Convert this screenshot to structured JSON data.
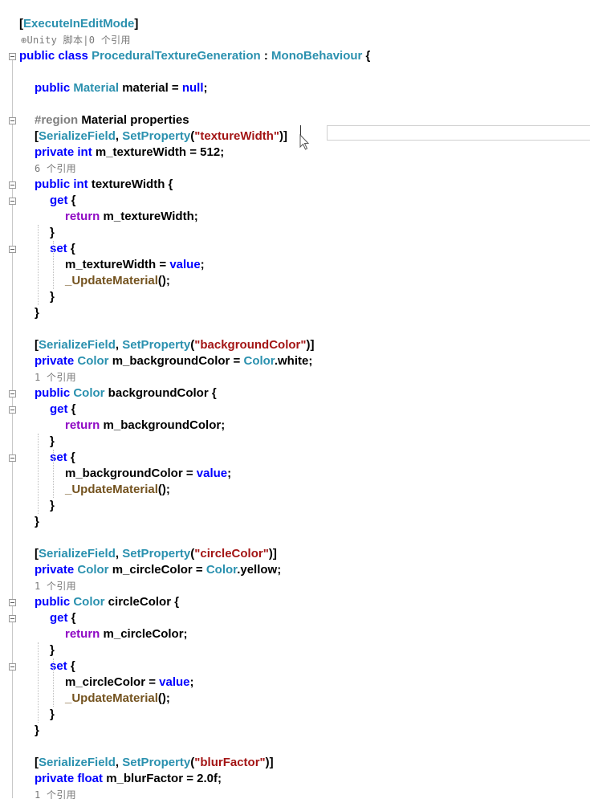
{
  "lines": [
    {
      "indent": 0,
      "tokens": [
        [
          "pun",
          "["
        ],
        [
          "attr",
          "ExecuteInEditMode"
        ],
        [
          "pun",
          "]"
        ]
      ]
    },
    {
      "indent": 0,
      "lens": "⊕Unity 脚本|0 个引用"
    },
    {
      "indent": 0,
      "tokens": [
        [
          "kw",
          "public "
        ],
        [
          "kw",
          "class "
        ],
        [
          "type",
          "ProceduralTextureGeneration"
        ],
        [
          "txt",
          " : "
        ],
        [
          "type",
          "MonoBehaviour"
        ],
        [
          "txt",
          " {"
        ]
      ]
    },
    {
      "indent": 0,
      "tokens": []
    },
    {
      "indent": 1,
      "tokens": [
        [
          "kw",
          "public "
        ],
        [
          "type",
          "Material"
        ],
        [
          "txt",
          " material = "
        ],
        [
          "kw",
          "null"
        ],
        [
          "txt",
          ";"
        ]
      ]
    },
    {
      "indent": 0,
      "tokens": []
    },
    {
      "indent": 1,
      "tokens": [
        [
          "dir",
          "#region "
        ],
        [
          "txt",
          "Material properties"
        ]
      ]
    },
    {
      "indent": 1,
      "tokens": [
        [
          "pun",
          "["
        ],
        [
          "attr",
          "SerializeField"
        ],
        [
          "txt",
          ", "
        ],
        [
          "attr",
          "SetProperty"
        ],
        [
          "txt",
          "("
        ],
        [
          "str",
          "\"textureWidth\""
        ],
        [
          "txt",
          ")]"
        ]
      ]
    },
    {
      "indent": 1,
      "tokens": [
        [
          "kw",
          "private "
        ],
        [
          "kw",
          "int "
        ],
        [
          "txt",
          "m_textureWidth = 512;"
        ]
      ]
    },
    {
      "indent": 1,
      "lens": "6 个引用"
    },
    {
      "indent": 1,
      "tokens": [
        [
          "kw",
          "public "
        ],
        [
          "kw",
          "int "
        ],
        [
          "txt",
          "textureWidth {"
        ]
      ]
    },
    {
      "indent": 2,
      "tokens": [
        [
          "kw",
          "get "
        ],
        [
          "txt",
          "{"
        ]
      ]
    },
    {
      "indent": 3,
      "tokens": [
        [
          "ctl",
          "return "
        ],
        [
          "txt",
          "m_textureWidth;"
        ]
      ]
    },
    {
      "indent": 2,
      "tokens": [
        [
          "txt",
          "}"
        ]
      ]
    },
    {
      "indent": 2,
      "tokens": [
        [
          "kw",
          "set "
        ],
        [
          "txt",
          "{"
        ]
      ]
    },
    {
      "indent": 3,
      "tokens": [
        [
          "txt",
          "m_textureWidth = "
        ],
        [
          "kw",
          "value"
        ],
        [
          "txt",
          ";"
        ]
      ]
    },
    {
      "indent": 3,
      "tokens": [
        [
          "meth",
          "_UpdateMaterial"
        ],
        [
          "txt",
          "();"
        ]
      ]
    },
    {
      "indent": 2,
      "tokens": [
        [
          "txt",
          "}"
        ]
      ]
    },
    {
      "indent": 1,
      "tokens": [
        [
          "txt",
          "}"
        ]
      ]
    },
    {
      "indent": 0,
      "tokens": []
    },
    {
      "indent": 1,
      "tokens": [
        [
          "pun",
          "["
        ],
        [
          "attr",
          "SerializeField"
        ],
        [
          "txt",
          ", "
        ],
        [
          "attr",
          "SetProperty"
        ],
        [
          "txt",
          "("
        ],
        [
          "str",
          "\"backgroundColor\""
        ],
        [
          "txt",
          ")]"
        ]
      ]
    },
    {
      "indent": 1,
      "tokens": [
        [
          "kw",
          "private "
        ],
        [
          "type",
          "Color"
        ],
        [
          "txt",
          " m_backgroundColor = "
        ],
        [
          "type",
          "Color"
        ],
        [
          "txt",
          ".white;"
        ]
      ]
    },
    {
      "indent": 1,
      "lens": "1 个引用"
    },
    {
      "indent": 1,
      "tokens": [
        [
          "kw",
          "public "
        ],
        [
          "type",
          "Color"
        ],
        [
          "txt",
          " backgroundColor {"
        ]
      ]
    },
    {
      "indent": 2,
      "tokens": [
        [
          "kw",
          "get "
        ],
        [
          "txt",
          "{"
        ]
      ]
    },
    {
      "indent": 3,
      "tokens": [
        [
          "ctl",
          "return "
        ],
        [
          "txt",
          "m_backgroundColor;"
        ]
      ]
    },
    {
      "indent": 2,
      "tokens": [
        [
          "txt",
          "}"
        ]
      ]
    },
    {
      "indent": 2,
      "tokens": [
        [
          "kw",
          "set "
        ],
        [
          "txt",
          "{"
        ]
      ]
    },
    {
      "indent": 3,
      "tokens": [
        [
          "txt",
          "m_backgroundColor = "
        ],
        [
          "kw",
          "value"
        ],
        [
          "txt",
          ";"
        ]
      ]
    },
    {
      "indent": 3,
      "tokens": [
        [
          "meth",
          "_UpdateMaterial"
        ],
        [
          "txt",
          "();"
        ]
      ]
    },
    {
      "indent": 2,
      "tokens": [
        [
          "txt",
          "}"
        ]
      ]
    },
    {
      "indent": 1,
      "tokens": [
        [
          "txt",
          "}"
        ]
      ]
    },
    {
      "indent": 0,
      "tokens": []
    },
    {
      "indent": 1,
      "tokens": [
        [
          "pun",
          "["
        ],
        [
          "attr",
          "SerializeField"
        ],
        [
          "txt",
          ", "
        ],
        [
          "attr",
          "SetProperty"
        ],
        [
          "txt",
          "("
        ],
        [
          "str",
          "\"circleColor\""
        ],
        [
          "txt",
          ")]"
        ]
      ]
    },
    {
      "indent": 1,
      "tokens": [
        [
          "kw",
          "private "
        ],
        [
          "type",
          "Color"
        ],
        [
          "txt",
          " m_circleColor = "
        ],
        [
          "type",
          "Color"
        ],
        [
          "txt",
          ".yellow;"
        ]
      ]
    },
    {
      "indent": 1,
      "lens": "1 个引用"
    },
    {
      "indent": 1,
      "tokens": [
        [
          "kw",
          "public "
        ],
        [
          "type",
          "Color"
        ],
        [
          "txt",
          " circleColor {"
        ]
      ]
    },
    {
      "indent": 2,
      "tokens": [
        [
          "kw",
          "get "
        ],
        [
          "txt",
          "{"
        ]
      ]
    },
    {
      "indent": 3,
      "tokens": [
        [
          "ctl",
          "return "
        ],
        [
          "txt",
          "m_circleColor;"
        ]
      ]
    },
    {
      "indent": 2,
      "tokens": [
        [
          "txt",
          "}"
        ]
      ]
    },
    {
      "indent": 2,
      "tokens": [
        [
          "kw",
          "set "
        ],
        [
          "txt",
          "{"
        ]
      ]
    },
    {
      "indent": 3,
      "tokens": [
        [
          "txt",
          "m_circleColor = "
        ],
        [
          "kw",
          "value"
        ],
        [
          "txt",
          ";"
        ]
      ]
    },
    {
      "indent": 3,
      "tokens": [
        [
          "meth",
          "_UpdateMaterial"
        ],
        [
          "txt",
          "();"
        ]
      ]
    },
    {
      "indent": 2,
      "tokens": [
        [
          "txt",
          "}"
        ]
      ]
    },
    {
      "indent": 1,
      "tokens": [
        [
          "txt",
          "}"
        ]
      ]
    },
    {
      "indent": 0,
      "tokens": []
    },
    {
      "indent": 1,
      "tokens": [
        [
          "pun",
          "["
        ],
        [
          "attr",
          "SerializeField"
        ],
        [
          "txt",
          ", "
        ],
        [
          "attr",
          "SetProperty"
        ],
        [
          "txt",
          "("
        ],
        [
          "str",
          "\"blurFactor\""
        ],
        [
          "txt",
          ")]"
        ]
      ]
    },
    {
      "indent": 1,
      "tokens": [
        [
          "kw",
          "private "
        ],
        [
          "kw",
          "float "
        ],
        [
          "txt",
          "m_blurFactor = 2.0f;"
        ]
      ]
    },
    {
      "indent": 1,
      "lens": "1 个引用"
    }
  ],
  "colors": {
    "attr": "#2b91af",
    "keyword": "#0000ff",
    "string": "#a31515",
    "control": "#8f08c4",
    "method": "#74531f"
  }
}
